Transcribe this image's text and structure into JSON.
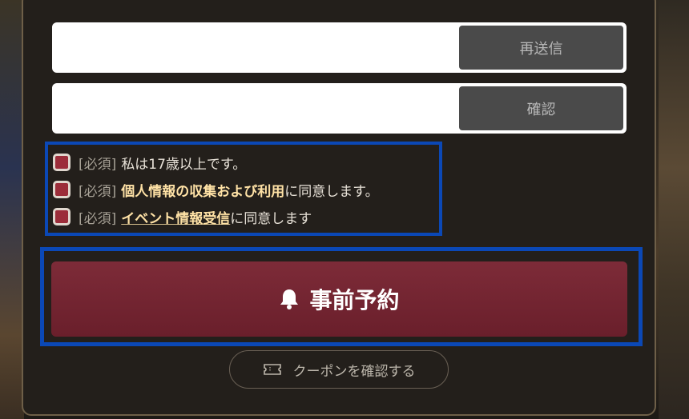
{
  "form": {
    "resend_label": "再送信",
    "confirm_label": "確認",
    "code_placeholder": "",
    "verify_placeholder": ""
  },
  "agreements": [
    {
      "required": "[必須]",
      "plain": "私は17歳以上です。",
      "link": "",
      "suffix": ""
    },
    {
      "required": "[必須]",
      "plain": "",
      "link": "個人情報の収集および利用",
      "suffix": "に同意します。"
    },
    {
      "required": "[必須]",
      "plain": "",
      "link": "イベント情報受信",
      "suffix": "に同意します"
    }
  ],
  "reserve": {
    "label": "事前予約",
    "icon": "bell-icon"
  },
  "coupon": {
    "label": "クーポンを確認する",
    "icon": "ticket-icon"
  },
  "colors": {
    "accent": "#7a2a36",
    "checkbox": "#9c2d3a",
    "highlight_frame": "#0b48b6",
    "link": "#ffe2a6"
  }
}
